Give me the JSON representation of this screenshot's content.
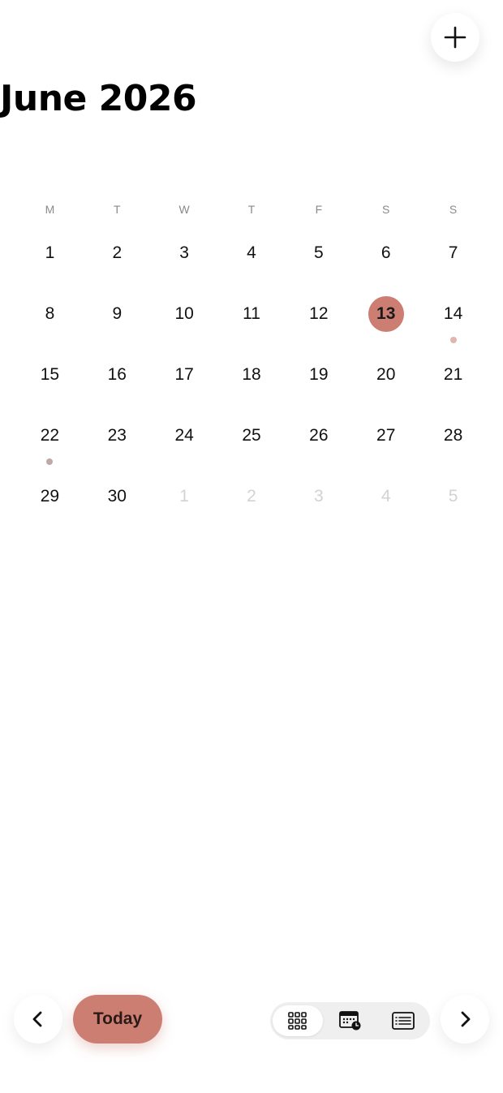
{
  "header": {
    "title": "June 2026",
    "add_icon": "plus-icon"
  },
  "calendar": {
    "weekdays": [
      "M",
      "T",
      "W",
      "T",
      "F",
      "S",
      "S"
    ],
    "weeks": [
      [
        {
          "d": "1"
        },
        {
          "d": "2"
        },
        {
          "d": "3"
        },
        {
          "d": "4"
        },
        {
          "d": "5"
        },
        {
          "d": "6"
        },
        {
          "d": "7"
        }
      ],
      [
        {
          "d": "8"
        },
        {
          "d": "9"
        },
        {
          "d": "10"
        },
        {
          "d": "11"
        },
        {
          "d": "12"
        },
        {
          "d": "13",
          "today": true
        },
        {
          "d": "14",
          "dot": "#e0b6ae"
        }
      ],
      [
        {
          "d": "15"
        },
        {
          "d": "16"
        },
        {
          "d": "17"
        },
        {
          "d": "18"
        },
        {
          "d": "19"
        },
        {
          "d": "20"
        },
        {
          "d": "21"
        }
      ],
      [
        {
          "d": "22",
          "dot": "#bda9a5"
        },
        {
          "d": "23"
        },
        {
          "d": "24"
        },
        {
          "d": "25"
        },
        {
          "d": "26"
        },
        {
          "d": "27"
        },
        {
          "d": "28"
        }
      ],
      [
        {
          "d": "29"
        },
        {
          "d": "30"
        },
        {
          "d": "1",
          "muted": true
        },
        {
          "d": "2",
          "muted": true
        },
        {
          "d": "3",
          "muted": true
        },
        {
          "d": "4",
          "muted": true
        },
        {
          "d": "5",
          "muted": true
        }
      ]
    ]
  },
  "toolbar": {
    "prev_icon": "chevron-left-icon",
    "today_label": "Today",
    "views": [
      {
        "icon": "month-grid-icon",
        "active": true
      },
      {
        "icon": "week-calendar-icon",
        "active": false
      },
      {
        "icon": "list-icon",
        "active": false
      }
    ],
    "next_icon": "chevron-right-icon"
  },
  "colors": {
    "accent": "#cc7e72",
    "dot_soft": "#e0b6ae",
    "dot_muted": "#bda9a5"
  }
}
